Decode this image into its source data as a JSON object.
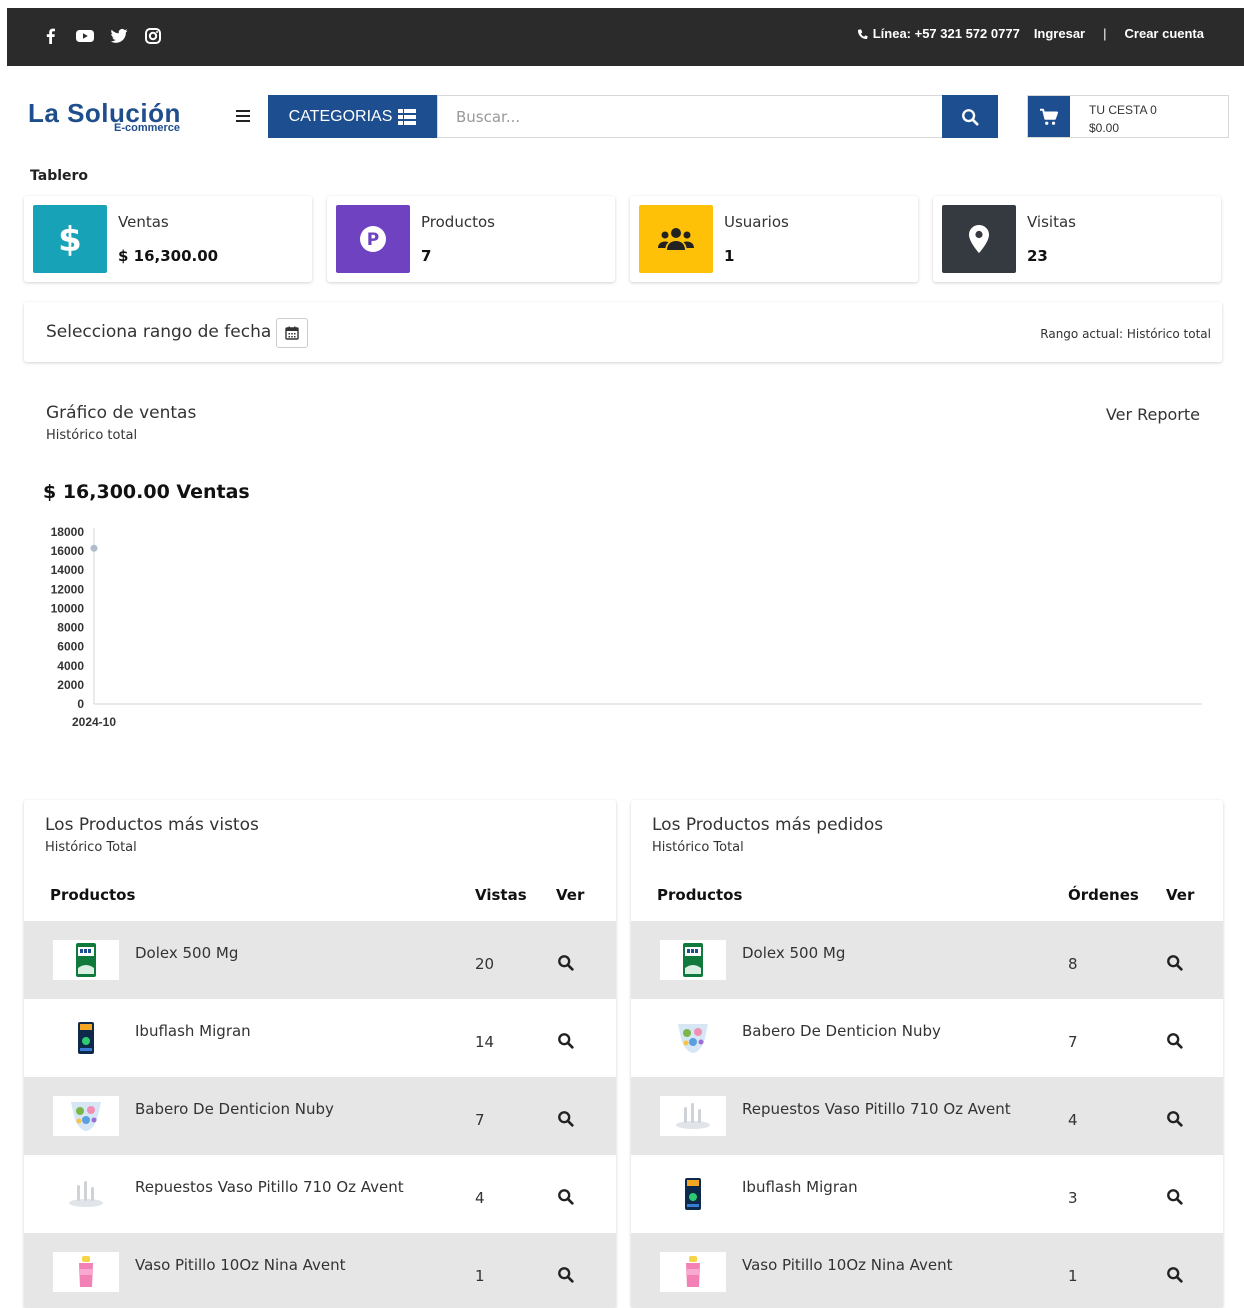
{
  "topbar": {
    "social": [
      "facebook-icon",
      "youtube-icon",
      "twitter-icon",
      "instagram-icon"
    ],
    "phone": "Línea: +57 321 572 0777",
    "login": "Ingresar",
    "separator": "|",
    "register": "Crear cuenta"
  },
  "header": {
    "logo_main": "La Solución",
    "logo_sub": "E-commerce",
    "categorias": "CATEGORIAS",
    "search_placeholder": "Buscar...",
    "cart_label": "TU CESTA 0",
    "cart_total": "$0.00"
  },
  "dashboard": {
    "title": "Tablero",
    "stats": [
      {
        "label": "Ventas",
        "value": "$ 16,300.00",
        "color": "#17a2b8",
        "icon": "dollar-icon"
      },
      {
        "label": "Productos",
        "value": "7",
        "color": "#6f42c1",
        "icon": "product-icon"
      },
      {
        "label": "Usuarios",
        "value": "1",
        "color": "#ffc107",
        "icon": "users-icon"
      },
      {
        "label": "Visitas",
        "value": "23",
        "color": "#343a40",
        "icon": "map-marker-icon"
      }
    ],
    "range_label": "Selecciona rango de fecha",
    "range_current": "Rango actual: Histórico total"
  },
  "chart": {
    "title": "Gráfico de ventas",
    "subtitle": "Histórico total",
    "report_link": "Ver Reporte",
    "total": "$ 16,300.00 Ventas"
  },
  "chart_data": {
    "type": "line",
    "title": "",
    "xlabel": "",
    "ylabel": "",
    "categories": [
      "2024-10"
    ],
    "series": [
      {
        "values": [
          16300
        ]
      }
    ],
    "ylim": [
      0,
      18000
    ],
    "yticks": [
      0,
      2000,
      4000,
      6000,
      8000,
      10000,
      12000,
      14000,
      16000,
      18000
    ],
    "grid": false,
    "color": "#b0bccc"
  },
  "most_viewed": {
    "title": "Los Productos más vistos",
    "subtitle": "Histórico Total",
    "col_product": "Productos",
    "col_metric": "Vistas",
    "col_view": "Ver",
    "rows": [
      {
        "name": "Dolex 500 Mg",
        "value": "20",
        "thumb": "dolex"
      },
      {
        "name": "Ibuflash Migran",
        "value": "14",
        "thumb": "ibuflash"
      },
      {
        "name": "Babero De Denticion Nuby",
        "value": "7",
        "thumb": "babero"
      },
      {
        "name": "Repuestos Vaso Pitillo 710 Oz Avent",
        "value": "4",
        "thumb": "repuestos"
      },
      {
        "name": "Vaso Pitillo 10Oz Nina Avent",
        "value": "1",
        "thumb": "vaso"
      }
    ]
  },
  "most_ordered": {
    "title": "Los Productos más pedidos",
    "subtitle": "Histórico Total",
    "col_product": "Productos",
    "col_metric": "Órdenes",
    "col_view": "Ver",
    "rows": [
      {
        "name": "Dolex 500 Mg",
        "value": "8",
        "thumb": "dolex"
      },
      {
        "name": "Babero De Denticion Nuby",
        "value": "7",
        "thumb": "babero"
      },
      {
        "name": "Repuestos Vaso Pitillo 710 Oz Avent",
        "value": "4",
        "thumb": "repuestos"
      },
      {
        "name": "Ibuflash Migran",
        "value": "3",
        "thumb": "ibuflash"
      },
      {
        "name": "Vaso Pitillo 10Oz Nina Avent",
        "value": "1",
        "thumb": "vaso"
      }
    ]
  }
}
